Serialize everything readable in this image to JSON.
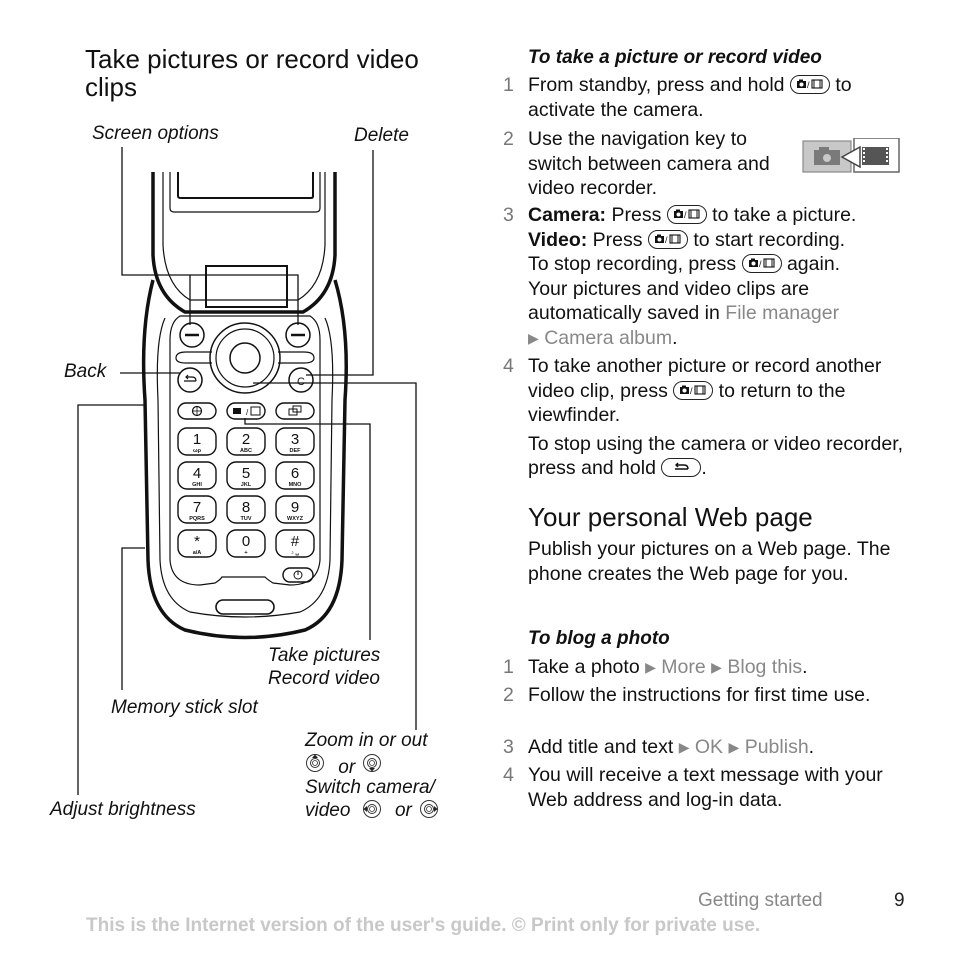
{
  "left": {
    "title_line1": "Take pictures or record video",
    "title_line2": "clips",
    "callouts": {
      "screen_options": "Screen options",
      "delete": "Delete",
      "back": "Back",
      "take_pictures": "Take pictures",
      "record_video": "Record video",
      "memory_stick_slot": "Memory stick slot",
      "zoom_in_out": "Zoom in or out",
      "or_1": "or",
      "switch_camera": "Switch camera/",
      "video": "video",
      "or_2": "or",
      "adjust_brightness": "Adjust brightness"
    },
    "keypad": [
      {
        "digit": "1",
        "letters": "ωρ"
      },
      {
        "digit": "2",
        "letters": "ABC"
      },
      {
        "digit": "3",
        "letters": "DEF"
      },
      {
        "digit": "4",
        "letters": "GHI"
      },
      {
        "digit": "5",
        "letters": "JKL"
      },
      {
        "digit": "6",
        "letters": "MNO"
      },
      {
        "digit": "7",
        "letters": "PQRS"
      },
      {
        "digit": "8",
        "letters": "TUV"
      },
      {
        "digit": "9",
        "letters": "WXYZ"
      },
      {
        "digit": "*",
        "letters": "a/A"
      },
      {
        "digit": "0",
        "letters": "+"
      },
      {
        "digit": "#",
        "letters": "♪ ␣"
      }
    ],
    "clear_key": "C"
  },
  "right": {
    "section1_subtitle": "To take a picture or record video",
    "steps1": [
      {
        "num": "1",
        "a": "From standby, press and hold",
        "b": "to activate the camera."
      },
      {
        "num": "2",
        "text": "Use the navigation key to switch between camera and video recorder."
      },
      {
        "num": "3",
        "camera_label": "Camera:",
        "camera_text_a": "Press",
        "camera_text_b": "to take a picture.",
        "video_label": "Video:",
        "video_text_a": "Press",
        "video_text_b": "to start recording.",
        "stop_a": "To stop recording, press",
        "stop_b": "again.",
        "saved_text": "Your pictures and video clips are automatically saved in",
        "menu1": "File manager",
        "menu2": "Camera album",
        "end": "."
      },
      {
        "num": "4",
        "a": "To take another picture or record another video clip, press",
        "b": "to return to the viewfinder.",
        "note_a": "To stop using the camera or video recorder, press and hold",
        "note_b": "."
      }
    ],
    "section2_title": "Your personal Web page",
    "section2_intro": "Publish your pictures on a Web page. The phone creates the Web page for you.",
    "section2_subtitle": "To blog a photo",
    "steps2": [
      {
        "num": "1",
        "text": "Take a photo",
        "menu1": "More",
        "menu2": "Blog this",
        "end": "."
      },
      {
        "num": "2",
        "text": "Follow the instructions for first time use."
      },
      {
        "num": "3",
        "text": "Add title and text",
        "menu1": "OK",
        "menu2": "Publish",
        "end": "."
      },
      {
        "num": "4",
        "text": "You will receive a text message with your Web address and log-in data."
      }
    ]
  },
  "footer": {
    "section": "Getting started",
    "page": "9",
    "note": "This is the Internet version of the user's guide. © Print only for private use."
  },
  "icons": {
    "camera_key": "camera-video-key-icon",
    "back_key": "back-key-icon",
    "menu_arrow": "▶"
  },
  "colors": {
    "menu_text": "#888888",
    "footer_note": "#c8c8c8",
    "step_number": "#777777"
  }
}
